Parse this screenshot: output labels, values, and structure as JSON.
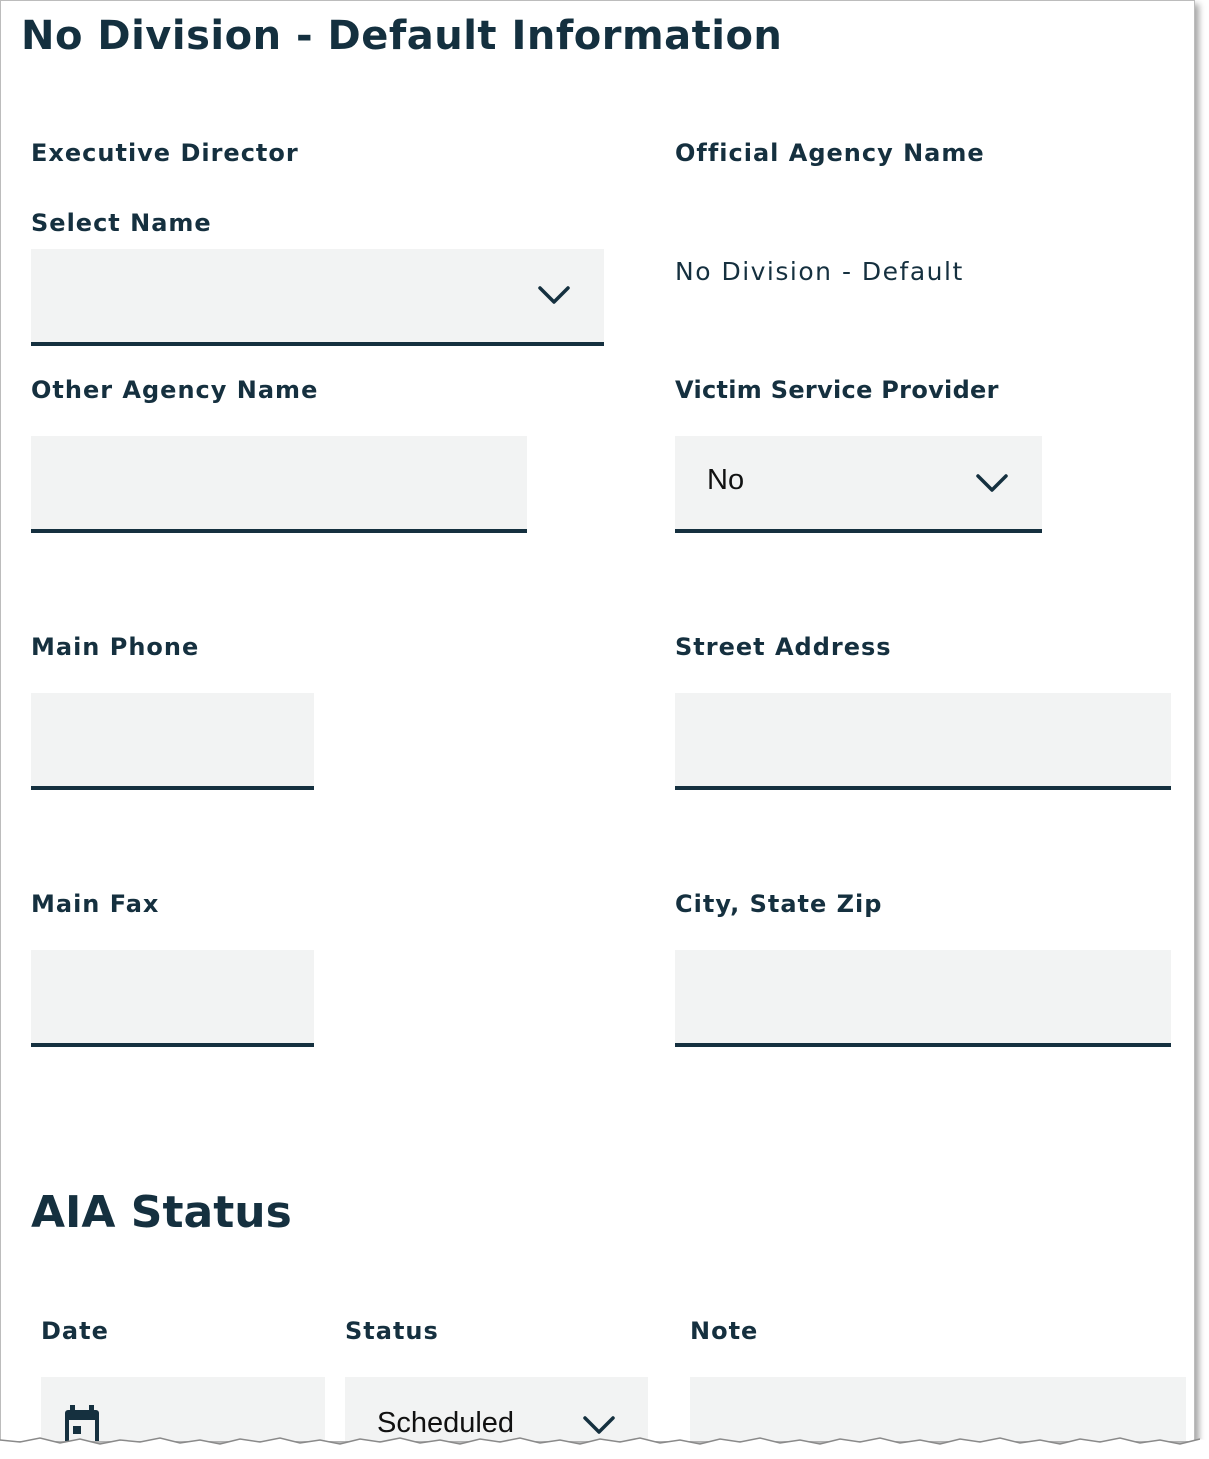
{
  "page": {
    "title": "No Division - Default Information"
  },
  "executive_director": {
    "label": "Executive Director",
    "select_label": "Select Name",
    "select_value": ""
  },
  "official_agency_name": {
    "label": "Official Agency Name",
    "value": "No Division - Default"
  },
  "other_agency_name": {
    "label": "Other Agency Name",
    "value": ""
  },
  "victim_service_provider": {
    "label": "Victim Service Provider",
    "value": "No"
  },
  "main_phone": {
    "label": "Main Phone",
    "value": ""
  },
  "street_address": {
    "label": "Street Address",
    "value": ""
  },
  "main_fax": {
    "label": "Main Fax",
    "value": ""
  },
  "city_state_zip": {
    "label": "City, State Zip",
    "value": ""
  },
  "aia_status": {
    "title": "AIA Status",
    "columns": {
      "date": "Date",
      "status": "Status",
      "note": "Note"
    },
    "row": {
      "date": "",
      "status": "Scheduled",
      "note": ""
    }
  },
  "icons": {
    "dropdown": "chevron-down-icon",
    "date": "calendar-icon"
  },
  "colors": {
    "text": "#15303f",
    "field_background": "#f2f3f3",
    "field_underline": "#15303f"
  }
}
